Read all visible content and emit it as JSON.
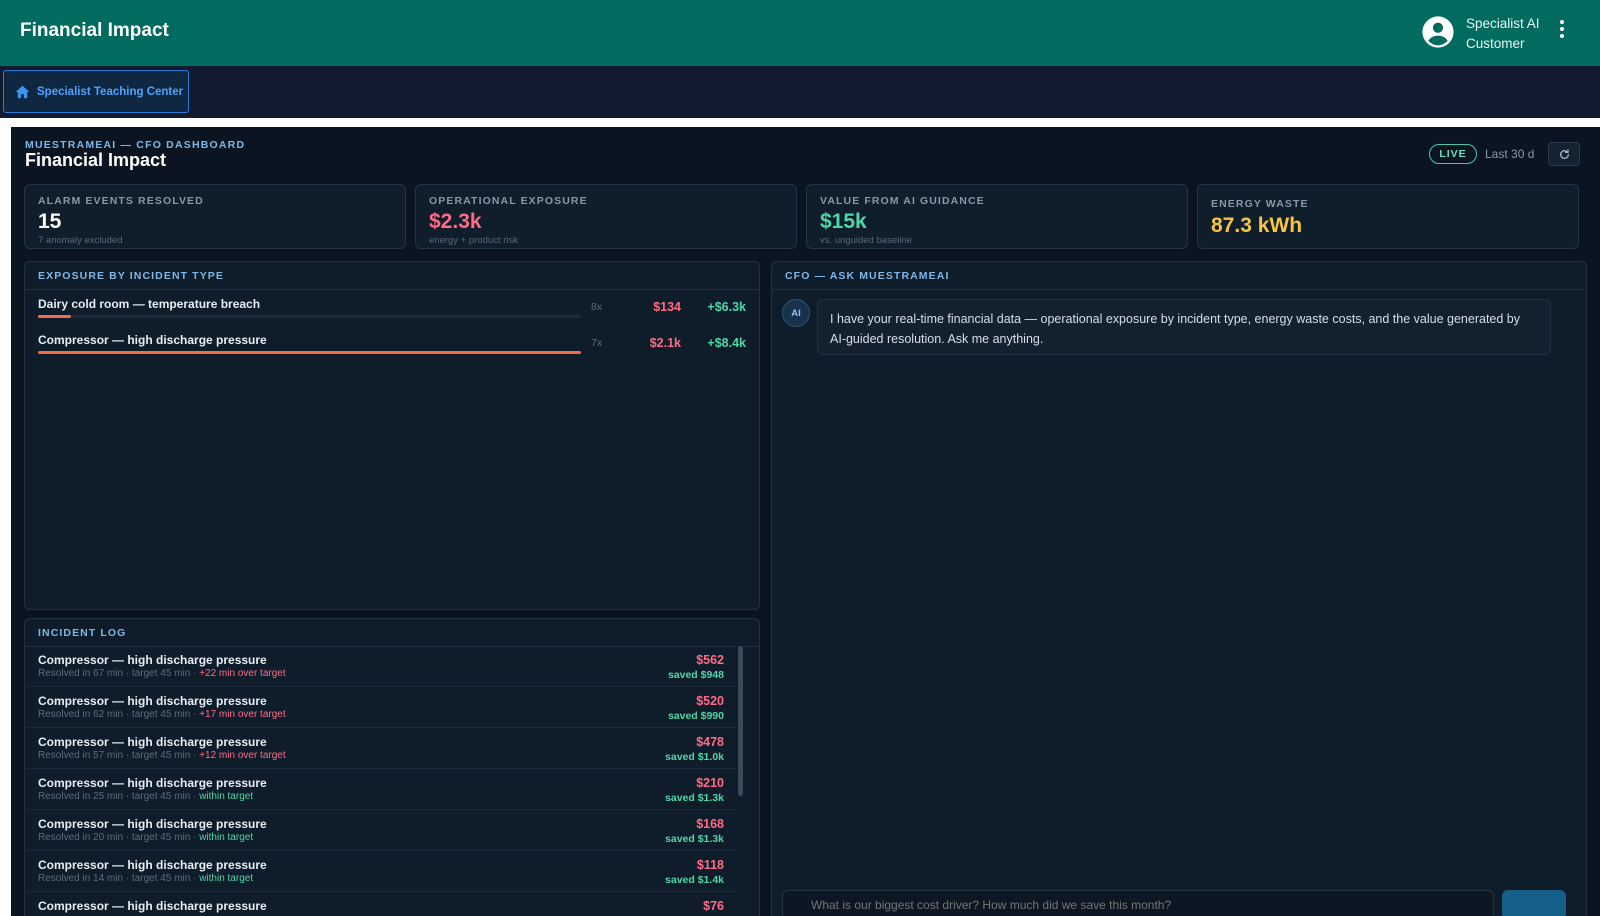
{
  "header": {
    "title": "Financial Impact",
    "user_name": "Specialist AI",
    "user_role": "Customer"
  },
  "nav": {
    "home_label": "Specialist Teaching Center"
  },
  "dashboard": {
    "eyebrow": "MUESTRAMEAI — CFO DASHBOARD",
    "title": "Financial Impact",
    "live_label": "LIVE",
    "range_label": "Last 30 d"
  },
  "kpis": [
    {
      "label": "ALARM EVENTS RESOLVED",
      "value": "15",
      "sub": "7 anomaly excluded",
      "color": "#ffffff"
    },
    {
      "label": "OPERATIONAL EXPOSURE",
      "value": "$2.3k",
      "sub": "energy + product risk",
      "color": "#ff6b86"
    },
    {
      "label": "VALUE FROM AI GUIDANCE",
      "value": "$15k",
      "sub": "vs. unguided baseline",
      "color": "#4fd6a8"
    },
    {
      "label": "ENERGY WASTE",
      "value": "87.3 kWh",
      "sub": "",
      "color": "#f5c542"
    }
  ],
  "exposure": {
    "heading": "EXPOSURE BY INCIDENT TYPE",
    "rows": [
      {
        "name": "Dairy cold room — temperature breach",
        "count": "8x",
        "cost": "$134",
        "saved": "+$6.3k",
        "share": 0.06
      },
      {
        "name": "Compressor — high discharge pressure",
        "count": "7x",
        "cost": "$2.1k",
        "saved": "+$8.4k",
        "share": 1.0
      }
    ]
  },
  "incident_log": {
    "heading": "INCIDENT LOG",
    "rows": [
      {
        "name": "Compressor — high discharge pressure",
        "resolved": "Resolved in 67 min · target 45 min ·",
        "status": "+22 min over target",
        "over": true,
        "cost": "$562",
        "saved": "saved $948"
      },
      {
        "name": "Compressor — high discharge pressure",
        "resolved": "Resolved in 62 min · target 45 min ·",
        "status": "+17 min over target",
        "over": true,
        "cost": "$520",
        "saved": "saved $990"
      },
      {
        "name": "Compressor — high discharge pressure",
        "resolved": "Resolved in 57 min · target 45 min ·",
        "status": "+12 min over target",
        "over": true,
        "cost": "$478",
        "saved": "saved $1.0k"
      },
      {
        "name": "Compressor — high discharge pressure",
        "resolved": "Resolved in 25 min · target 45 min ·",
        "status": "within target",
        "over": false,
        "cost": "$210",
        "saved": "saved $1.3k"
      },
      {
        "name": "Compressor — high discharge pressure",
        "resolved": "Resolved in 20 min · target 45 min ·",
        "status": "within target",
        "over": false,
        "cost": "$168",
        "saved": "saved $1.3k"
      },
      {
        "name": "Compressor — high discharge pressure",
        "resolved": "Resolved in 14 min · target 45 min ·",
        "status": "within target",
        "over": false,
        "cost": "$118",
        "saved": "saved $1.4k"
      },
      {
        "name": "Compressor — high discharge pressure",
        "resolved": "",
        "status": "",
        "over": false,
        "cost": "$76",
        "saved": ""
      }
    ]
  },
  "chat": {
    "heading": "CFO — ASK MUESTRAMEAI",
    "ai_label": "AI",
    "message": "I have your real-time financial data — operational exposure by incident type, energy waste costs, and the value generated by AI-guided resolution. Ask me anything.",
    "placeholder": "What is our biggest cost driver? How much did we save this month?"
  },
  "icons": {
    "home": "home-icon",
    "avatar": "account-circle-icon",
    "menu": "more-vert-icon",
    "refresh": "refresh-icon"
  }
}
